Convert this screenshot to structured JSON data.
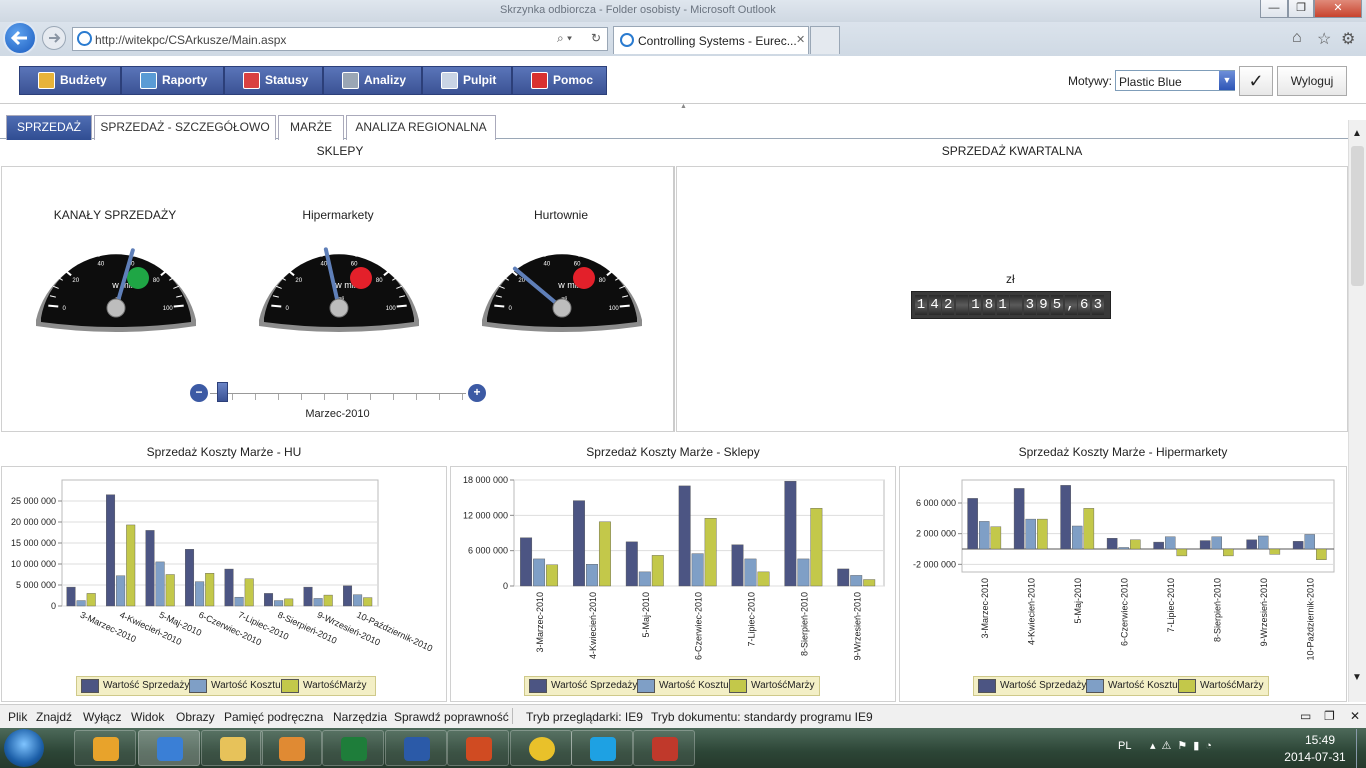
{
  "window": {
    "title": "Skrzynka odbiorcza - Folder osobisty - Microsoft Outlook",
    "min": "—",
    "max": "❐",
    "close": "✕"
  },
  "browser": {
    "url": "http://witekpc/CSArkusze/Main.aspx",
    "tab_title": "Controlling Systems - Eurec...",
    "back_icon": "back-arrow-icon",
    "forward_icon": "forward-arrow-icon"
  },
  "app_menu": [
    {
      "label": "Budżety",
      "color": "#e8b33a"
    },
    {
      "label": "Raporty",
      "color": "#5a9bd5"
    },
    {
      "label": "Statusy",
      "color": "#d94141"
    },
    {
      "label": "Analizy",
      "color": "#9aa6b5"
    },
    {
      "label": "Pulpit",
      "color": "#c9d4e5"
    },
    {
      "label": "Pomoc",
      "color": "#d9312f"
    }
  ],
  "theme": {
    "label": "Motywy:",
    "value": "Plastic Blue"
  },
  "logout": "Wyloguj",
  "tabs": [
    "SPRZEDAŻ",
    "SPRZEDAŻ - SZCZEGÓŁOWO",
    "MARŻE",
    "ANALIZA REGIONALNA"
  ],
  "shops_panel": {
    "title": "SKLEPY",
    "gauges": [
      {
        "title": "KANAŁY SPRZEDAŻY",
        "value": 59,
        "unit": "w mln",
        "currency": "zł",
        "indicator": "#1fa645"
      },
      {
        "title": "Hipermarkety",
        "value": 43,
        "unit": "w mln",
        "currency": "zł",
        "indicator": "#e3202a"
      },
      {
        "title": "Hurtownie",
        "value": 22,
        "unit": "w mln",
        "currency": "zł",
        "indicator": "#e3202a"
      }
    ],
    "ticks": [
      "0",
      "20",
      "40",
      "60",
      "80",
      "100"
    ],
    "slider_label": "Marzec-2010"
  },
  "quarterly_panel": {
    "title": "SPRZEDAŻ KWARTALNA",
    "currency": "zł",
    "digits": [
      "1",
      "4",
      "2",
      " ",
      "1",
      "8",
      "1",
      " ",
      "3",
      "9",
      "5",
      ",",
      "6",
      "3"
    ]
  },
  "charts": [
    {
      "title": "Sprzedaż Koszty Marże - HU",
      "type": "bar",
      "categories": [
        "3-Marzec-2010",
        "4-Kwiecień-2010",
        "5-Maj-2010",
        "6-Czerwiec-2010",
        "7-Lipiec-2010",
        "8-Sierpień-2010",
        "9-Wrzesień-2010",
        "10-Październik-2010"
      ],
      "series": [
        {
          "name": "Wartość Sprzedaży",
          "values": [
            4500000,
            26500000,
            18000000,
            13500000,
            8800000,
            3000000,
            4500000,
            4800000
          ]
        },
        {
          "name": "Wartość Kosztu",
          "values": [
            1300000,
            7200000,
            10500000,
            5800000,
            2100000,
            1300000,
            1800000,
            2700000
          ]
        },
        {
          "name": "WartośćMarży",
          "values": [
            3000000,
            19300000,
            7500000,
            7800000,
            6500000,
            1700000,
            2600000,
            2000000
          ]
        }
      ],
      "yticks": [
        "0",
        "5 000 000",
        "10 000 000",
        "15 000 000",
        "20 000 000",
        "25 000 000"
      ],
      "ylim": [
        0,
        30000000
      ]
    },
    {
      "title": "Sprzedaż Koszty Marże - Sklepy",
      "type": "bar",
      "categories": [
        "3-Marzec-2010",
        "4-Kwiecień-2010",
        "5-Maj-2010",
        "6-Czerwiec-2010",
        "7-Lipiec-2010",
        "8-Sierpień-2010",
        "9-Wrzesień-2010"
      ],
      "series": [
        {
          "name": "Wartość Sprzedaży",
          "values": [
            8200000,
            14500000,
            7500000,
            17000000,
            7000000,
            17800000,
            2900000
          ]
        },
        {
          "name": "Wartość Kosztu",
          "values": [
            4600000,
            3700000,
            2400000,
            5500000,
            4600000,
            4600000,
            1800000
          ]
        },
        {
          "name": "WartośćMarży",
          "values": [
            3600000,
            10900000,
            5200000,
            11500000,
            2400000,
            13200000,
            1100000
          ]
        }
      ],
      "yticks": [
        "0",
        "6 000 000",
        "12 000 000",
        "18 000 000"
      ],
      "ylim": [
        0,
        18000000
      ]
    },
    {
      "title": "Sprzedaż Koszty Marże - Hipermarkety",
      "type": "bar",
      "categories": [
        "3-Marzec-2010",
        "4-Kwiecień-2010",
        "5-Maj-2010",
        "6-Czerwiec-2010",
        "7-Lipiec-2010",
        "8-Sierpień-2010",
        "9-Wrzesień-2010",
        "10-Październik-2010"
      ],
      "series": [
        {
          "name": "Wartość Sprzedaży",
          "values": [
            6600000,
            7900000,
            8300000,
            1400000,
            900000,
            1100000,
            1200000,
            1000000
          ]
        },
        {
          "name": "Wartość Kosztu",
          "values": [
            3600000,
            3900000,
            3000000,
            200000,
            1600000,
            1600000,
            1700000,
            1900000
          ]
        },
        {
          "name": "WartośćMarży",
          "values": [
            2900000,
            3900000,
            5300000,
            1200000,
            -900000,
            -900000,
            -700000,
            -1400000
          ]
        }
      ],
      "yticks": [
        "-2 000 000",
        "2 000 000",
        "6 000 000"
      ],
      "ylim": [
        -3000000,
        9000000
      ]
    }
  ],
  "series_colors": [
    "#4c5583",
    "#7f9fc6",
    "#c3c84a"
  ],
  "statusbar": {
    "menus": [
      "Plik",
      "Znajdź",
      "Wyłącz",
      "Widok",
      "Obrazy",
      "Pamięć podręczna",
      "Narzędzia",
      "Sprawdź poprawność"
    ],
    "mode": "Tryb przeglądarki:  IE9",
    "doc_mode": "Tryb dokumentu: standardy programu IE9"
  },
  "taskbar": {
    "apps": [
      "outlook",
      "internet-explorer",
      "file-explorer",
      "media",
      "excel",
      "word",
      "powerpoint",
      "chrome",
      "skype",
      "toolbox"
    ],
    "lang": "PL",
    "time": "15:49",
    "date": "2014-07-31"
  }
}
